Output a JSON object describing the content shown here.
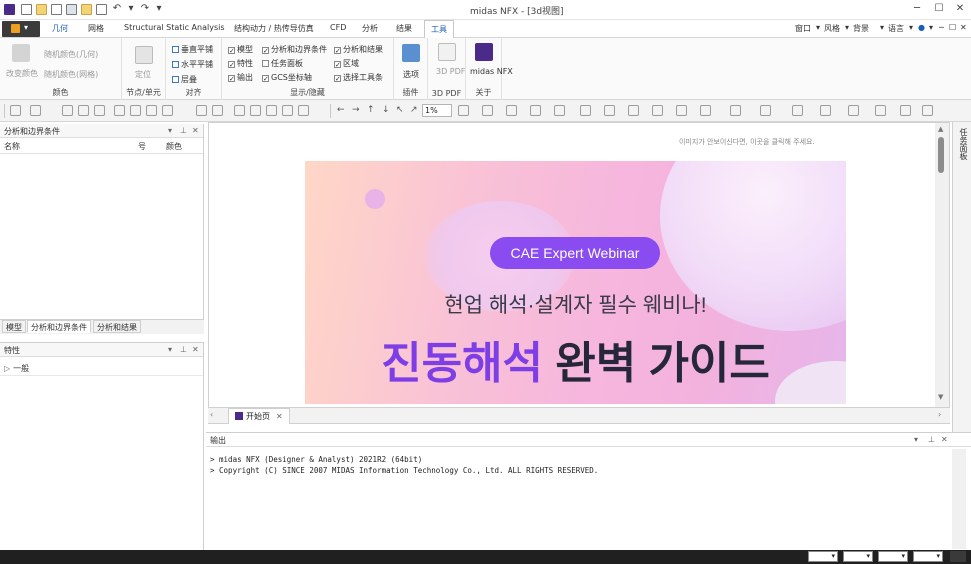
{
  "app": {
    "title": "midas NFX - [3d视图]"
  },
  "menu": {
    "file_label": "",
    "tabs": [
      "几何",
      "网格",
      "Structural Static Analysis",
      "结构动力 / 热传导仿真",
      "CFD",
      "分析",
      "结果",
      "工具"
    ],
    "active_tab": "工具",
    "right": [
      "窗口",
      "风格",
      "背景",
      "语言"
    ]
  },
  "ribbon": {
    "color_group": {
      "label": "颜色",
      "items": [
        "改变颜色",
        "随机颜色(几何)",
        "随机颜色(网格)"
      ]
    },
    "node_group": {
      "label": "节点/单元",
      "items": [
        "定位"
      ]
    },
    "align_group": {
      "label": "对齐",
      "items": [
        "垂直平铺",
        "水平平铺",
        "层叠"
      ]
    },
    "display_group": {
      "label": "显示/隐藏",
      "col1": [
        "模型",
        "特性",
        "输出"
      ],
      "col2": [
        "分析和边界条件",
        "任务面板",
        "GCS坐标轴"
      ],
      "col3": [
        "分析和结果",
        "区域",
        "选择工具条"
      ]
    },
    "plugin_group": {
      "label": "插件",
      "items": [
        "选项"
      ]
    },
    "pdf_group": {
      "label": "3D PDF",
      "items": [
        "3D PDF"
      ]
    },
    "about_group": {
      "label": "关于",
      "items": [
        "midas NFX"
      ]
    }
  },
  "toolbar": {
    "zoom": "1%"
  },
  "left_panel": {
    "title": "分析和边界条件",
    "columns": [
      "名称",
      "号",
      "颜色"
    ],
    "tabs": [
      "模型",
      "分析和边界条件",
      "分析和结果"
    ],
    "active_tab": "分析和边界条件"
  },
  "props_panel": {
    "title": "特性",
    "tree": [
      "一般"
    ]
  },
  "doc": {
    "notice": "이미지가 안보이신다면, 이곳을 클릭해 주세요.",
    "tab_label": "开始页",
    "banner": {
      "pill": "CAE Expert Webinar",
      "subtitle": "현업 해석·설계자 필수 웨비나!",
      "title_accent": "진동해석",
      "title_rest": " 완벽 가이드"
    }
  },
  "output": {
    "title": "输出",
    "lines": [
      "> midas NFX (Designer & Analyst) 2021R2 (64bit)",
      "> Copyright (C) SINCE 2007 MIDAS Information Technology Co., Ltd. ALL RIGHTS RESERVED."
    ]
  },
  "right_tab": {
    "label": "任务面板"
  },
  "colors": {
    "accent": "#1a5fb4",
    "pill": "#8a4cf0",
    "title_accent": "#7d3ee6",
    "status_bar": "#202020"
  }
}
